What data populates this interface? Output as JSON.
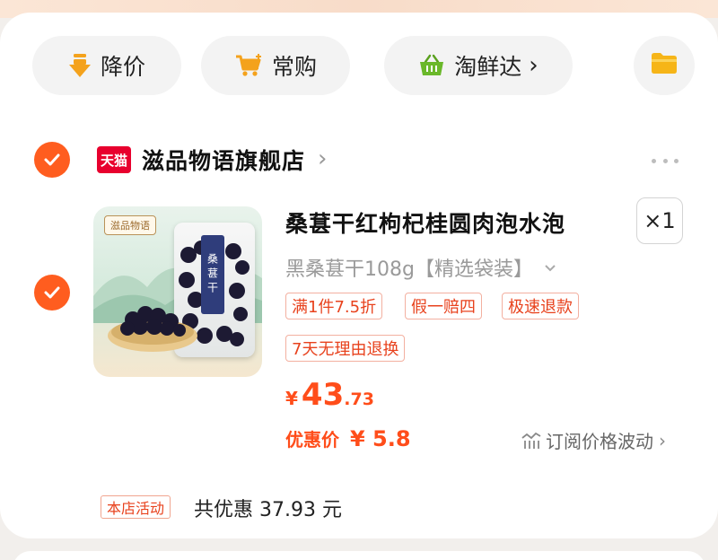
{
  "quick_filters": [
    {
      "label": "降价",
      "icon": "price-drop-arrow-icon"
    },
    {
      "label": "常购",
      "icon": "shopping-cart-icon"
    },
    {
      "label": "淘鲜达",
      "icon": "basket-icon",
      "chevron": "›"
    },
    {
      "label": "",
      "icon": "folder-icon"
    }
  ],
  "store": {
    "badge": "天猫",
    "name": "滋品物语旗舰店",
    "chevron": "›"
  },
  "product": {
    "image_brand": "滋品物语",
    "image_bag_label": "桑葚干",
    "title": "桑葚干红枸杞桂圆肉泡水泡",
    "quantity": "×1",
    "sku": "黑桑葚干108g【精选袋装】",
    "tags": [
      "满1件7.5折",
      "假一赔四",
      "极速退款",
      "7天无理由退换"
    ],
    "price": {
      "symbol": "¥",
      "integer": "43",
      "decimal": ".73"
    },
    "discount": {
      "label": "优惠价",
      "value": "¥ 5.8"
    },
    "subscribe_label": "订阅价格波动",
    "subscribe_chevron": "›"
  },
  "activity": {
    "tag": "本店活动",
    "text": "共优惠 37.93 元"
  },
  "colors": {
    "accent": "#ff4d1a",
    "check": "#ff5d1f",
    "tmall_red": "#e8002e"
  }
}
